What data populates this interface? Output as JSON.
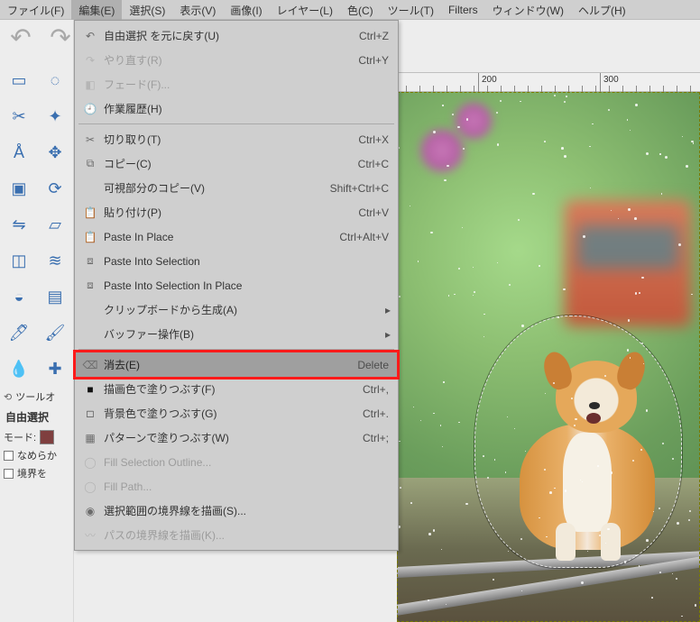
{
  "menubar": [
    {
      "label": "ファイル(F)"
    },
    {
      "label": "編集(E)",
      "open": true
    },
    {
      "label": "選択(S)"
    },
    {
      "label": "表示(V)"
    },
    {
      "label": "画像(I)"
    },
    {
      "label": "レイヤー(L)"
    },
    {
      "label": "色(C)"
    },
    {
      "label": "ツール(T)"
    },
    {
      "label": "Filters"
    },
    {
      "label": "ウィンドウ(W)"
    },
    {
      "label": "ヘルプ(H)"
    }
  ],
  "edit_menu": [
    {
      "kind": "item",
      "icon": "undo-icon",
      "label": "自由選択 を元に戻す(U)",
      "accel": "Ctrl+Z"
    },
    {
      "kind": "item",
      "icon": "redo-icon",
      "label": "やり直す(R)",
      "accel": "Ctrl+Y",
      "disabled": true
    },
    {
      "kind": "item",
      "icon": "fade-icon",
      "label": "フェード(F)...",
      "disabled": true
    },
    {
      "kind": "item",
      "icon": "history-icon",
      "label": "作業履歴(H)"
    },
    {
      "kind": "sep"
    },
    {
      "kind": "item",
      "icon": "cut-icon",
      "label": "切り取り(T)",
      "accel": "Ctrl+X"
    },
    {
      "kind": "item",
      "icon": "copy-icon",
      "label": "コピー(C)",
      "accel": "Ctrl+C"
    },
    {
      "kind": "item",
      "icon": "",
      "label": "可視部分のコピー(V)",
      "accel": "Shift+Ctrl+C"
    },
    {
      "kind": "item",
      "icon": "paste-icon",
      "label": "貼り付け(P)",
      "accel": "Ctrl+V"
    },
    {
      "kind": "item",
      "icon": "paste-icon",
      "label": "Paste In Place",
      "accel": "Ctrl+Alt+V"
    },
    {
      "kind": "item",
      "icon": "paste-into-icon",
      "label": "Paste Into Selection"
    },
    {
      "kind": "item",
      "icon": "paste-into-icon",
      "label": "Paste Into Selection In Place"
    },
    {
      "kind": "item",
      "icon": "",
      "label": "クリップボードから生成(A)",
      "submenu": true
    },
    {
      "kind": "item",
      "icon": "",
      "label": "バッファー操作(B)",
      "submenu": true
    },
    {
      "kind": "sep"
    },
    {
      "kind": "item",
      "icon": "erase-icon",
      "label": "消去(E)",
      "accel": "Delete",
      "highlight": true,
      "emphasis": true
    },
    {
      "kind": "item",
      "icon": "fill-fg-icon",
      "label": "描画色で塗りつぶす(F)",
      "accel": "Ctrl+,"
    },
    {
      "kind": "item",
      "icon": "fill-bg-icon",
      "label": "背景色で塗りつぶす(G)",
      "accel": "Ctrl+."
    },
    {
      "kind": "item",
      "icon": "fill-pattern-icon",
      "label": "パターンで塗りつぶす(W)",
      "accel": "Ctrl+;"
    },
    {
      "kind": "item",
      "icon": "stroke-icon",
      "label": "Fill Selection Outline...",
      "disabled": true
    },
    {
      "kind": "item",
      "icon": "stroke-icon",
      "label": "Fill Path...",
      "disabled": true
    },
    {
      "kind": "item",
      "icon": "stroke-sel-icon",
      "label": "選択範囲の境界線を描画(S)..."
    },
    {
      "kind": "item",
      "icon": "stroke-path-icon",
      "label": "パスの境界線を描画(K)...",
      "disabled": true
    }
  ],
  "ruler": {
    "ticks": [
      {
        "pos": 90,
        "label": "200"
      },
      {
        "pos": 225,
        "label": "300"
      }
    ]
  },
  "tool_options": {
    "panel_title": "ツールオ",
    "tool_label": "自由選択",
    "mode_label": "モード:",
    "antialias_label": "なめらか",
    "boundary_label": "境界を"
  },
  "toolbox_tools": [
    "rect-select",
    "free-select",
    "scissors",
    "fg-select",
    "measure",
    "move",
    "crop",
    "rotate",
    "flip",
    "perspective",
    "cage",
    "warp",
    "bucket",
    "gradient",
    "ink",
    "brush",
    "smudge",
    "heal"
  ]
}
